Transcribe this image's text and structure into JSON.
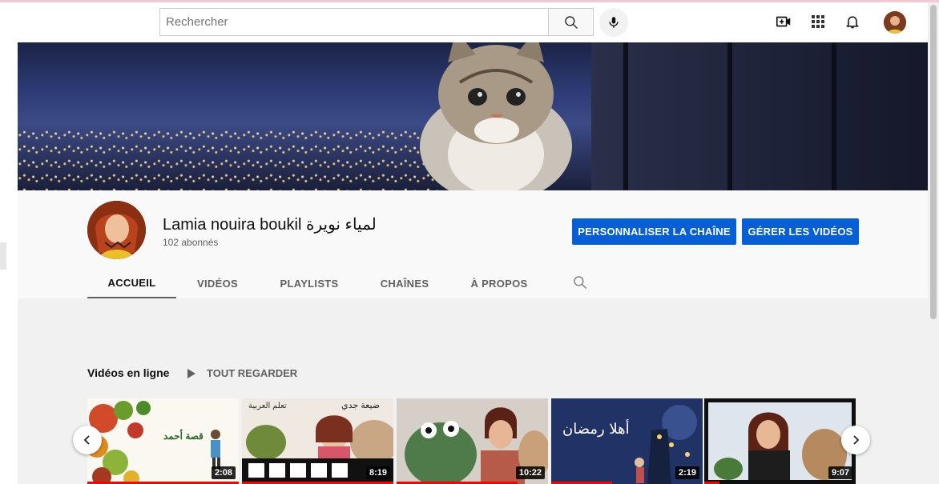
{
  "search": {
    "placeholder": "Rechercher"
  },
  "channel": {
    "name": "Lamia nouira boukil لمياء نويرة",
    "subscribers": "102 abonnés",
    "customize_label": "PERSONNALISER LA CHAÎNE",
    "manage_label": "GÉRER LES VIDÉOS"
  },
  "tabs": [
    "ACCUEIL",
    "VIDÉOS",
    "PLAYLISTS",
    "CHAÎNES",
    "À PROPOS"
  ],
  "shelf": {
    "title": "Vidéos en ligne",
    "play_all": "TOUT REGARDER",
    "videos": [
      {
        "duration": "2:08",
        "thumb_text": "قصة أحمد",
        "watched": 1.0
      },
      {
        "duration": "8:19",
        "thumb_text": "ضيعة جدي",
        "thumb_text2": "تعلم العربية",
        "watched": 1.0
      },
      {
        "duration": "10:22",
        "watched": 0.8
      },
      {
        "duration": "2:19",
        "thumb_text": "أهلا رمضان",
        "watched": 0.4
      },
      {
        "duration": "9:07",
        "watched": 0.1
      }
    ]
  },
  "icons": {
    "search": "search-icon",
    "mic": "microphone-icon",
    "create": "video-create-icon",
    "apps": "apps-grid-icon",
    "notifications": "bell-icon",
    "prev": "chevron-left-icon",
    "next": "chevron-right-icon"
  },
  "colors": {
    "accent": "#065fd4",
    "progress": "#ff0000"
  }
}
